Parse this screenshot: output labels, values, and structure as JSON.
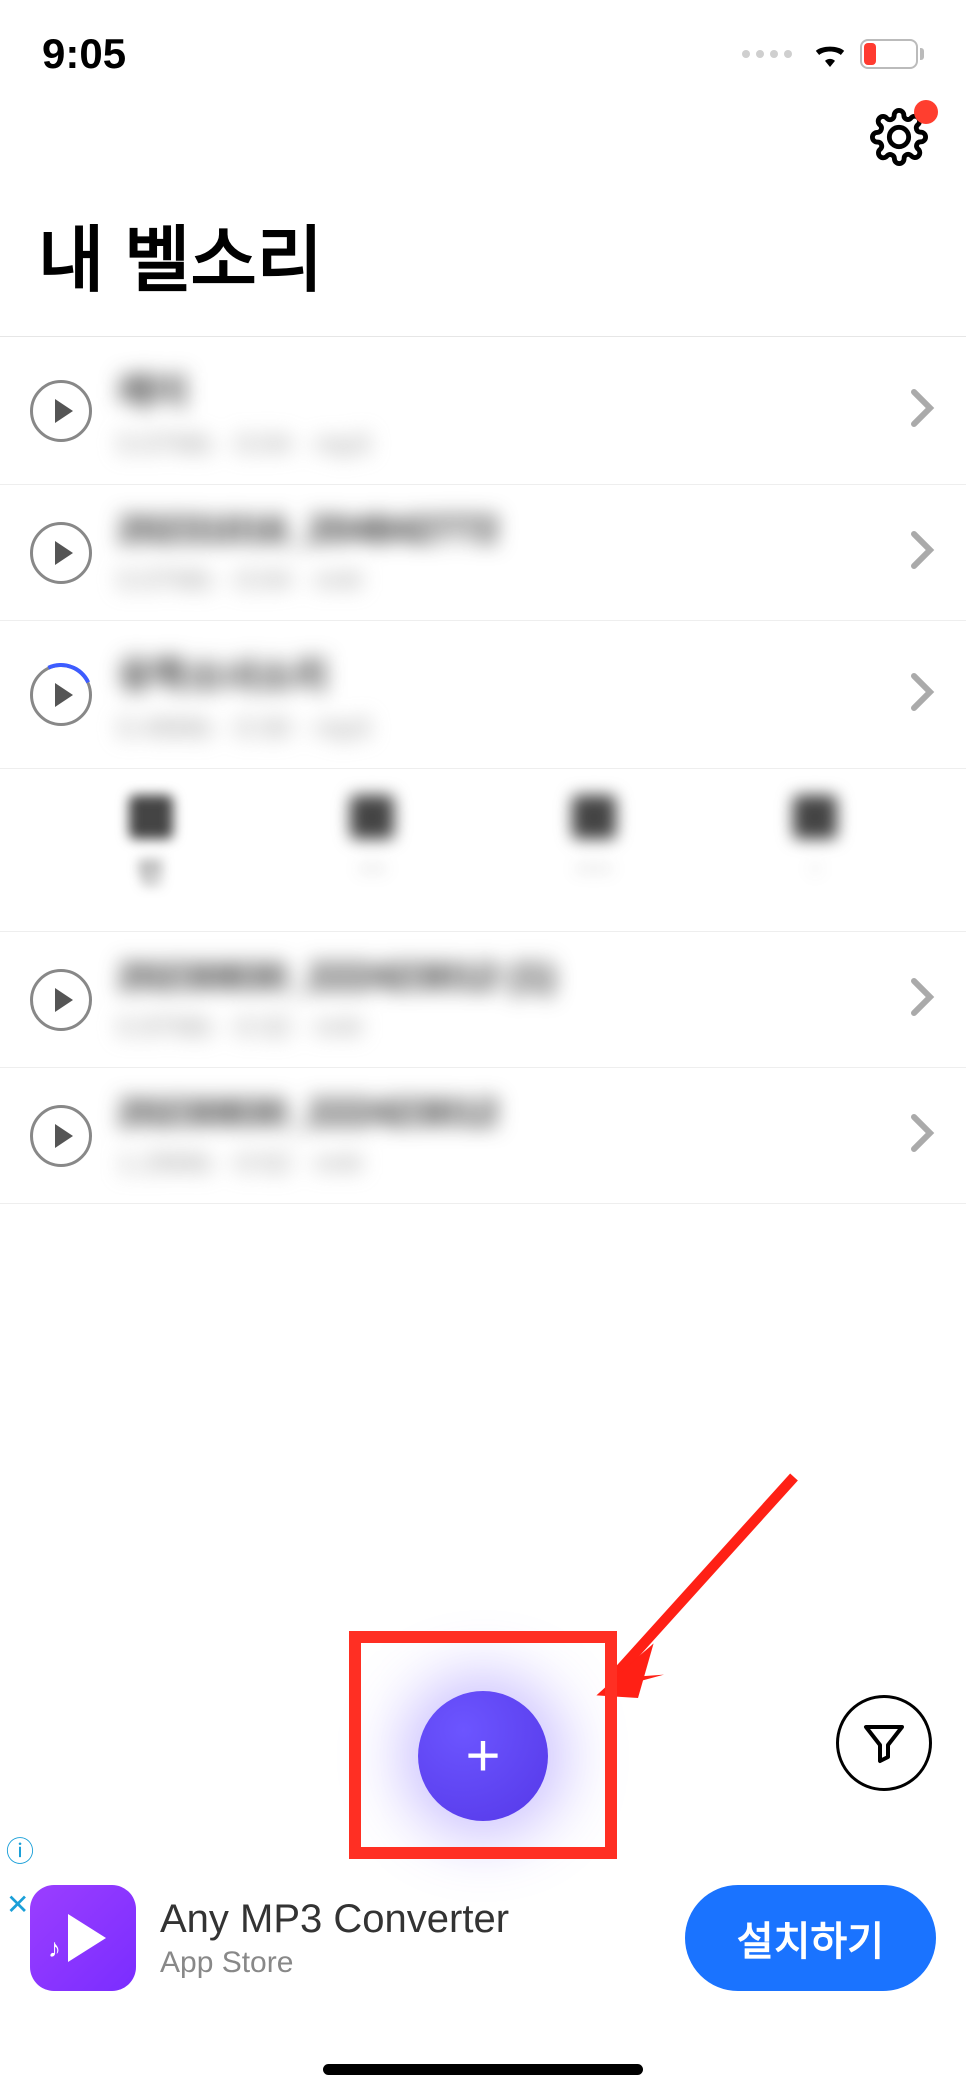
{
  "status": {
    "time": "9:05",
    "battery_pct": "11"
  },
  "header": {
    "title": "내 벨소리"
  },
  "items": [
    {
      "title": "레이",
      "meta": "0.07Mb · 0:04 · mp3",
      "partial": false
    },
    {
      "title": "20231016_204842772",
      "meta": "0.07Mb · 0:04 · m4r",
      "partial": false
    },
    {
      "title": "유학소녀소리",
      "meta": "0.49Mb · 0:30 · mp3",
      "partial": true
    },
    {
      "title": "20230830_222423012 (1)",
      "meta": "0.97Mb · 0:32 · m4r",
      "partial": false
    },
    {
      "title": "20230830_222423012",
      "meta": "1.29Mb · 0:52 · m4r",
      "partial": false
    }
  ],
  "tabs": {
    "visible_partial_label": "민"
  },
  "ad": {
    "title": "Any MP3 Converter",
    "subtitle": "App Store",
    "button": "설치하기"
  }
}
